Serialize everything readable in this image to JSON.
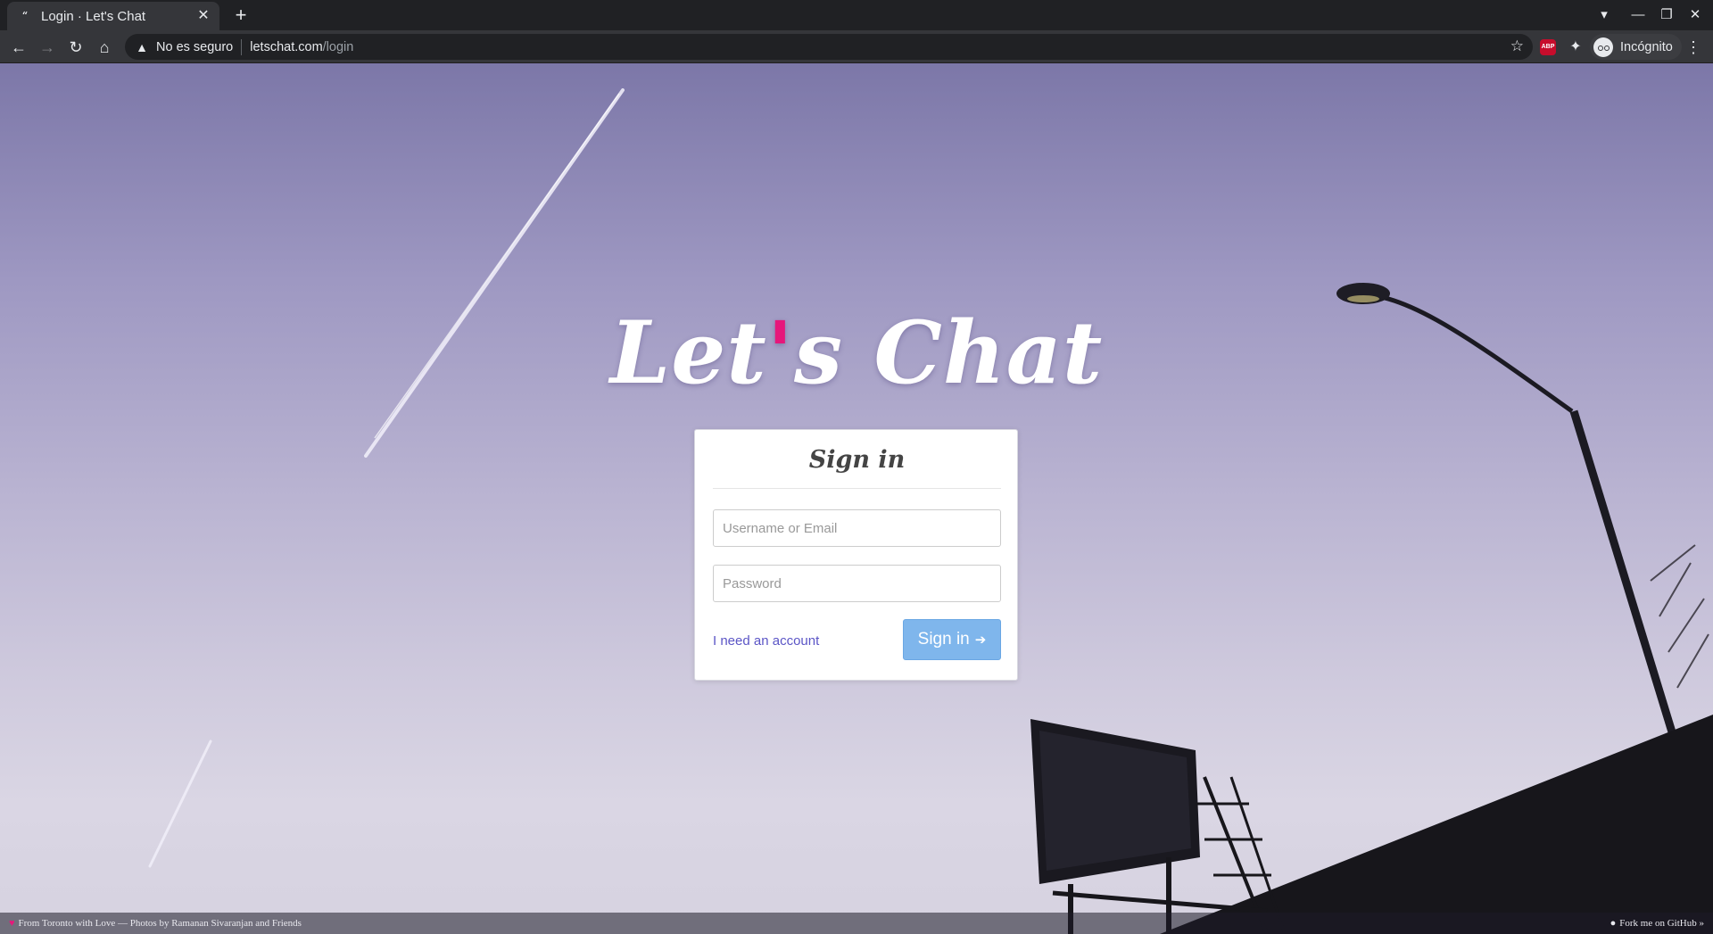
{
  "browser": {
    "tab": {
      "favicon": "“",
      "title": "Login · Let's Chat",
      "close": "✕"
    },
    "new_tab": "+",
    "window_controls": {
      "tab_search": "▾",
      "minimize": "—",
      "restore": "❐",
      "close": "✕"
    },
    "nav": {
      "back": "←",
      "forward": "→",
      "reload": "↻",
      "home": "⌂"
    },
    "address": {
      "warning_icon": "▲",
      "security_label": "No es seguro",
      "host": "letschat.com",
      "path": "/login",
      "star": "☆"
    },
    "extensions": {
      "abp": "ABP",
      "puzzle": "✦"
    },
    "profile_label": "Incógnito",
    "menu": "⋮"
  },
  "page": {
    "logo": {
      "part1": "Let",
      "apostrophe": "'",
      "part2": "s Chat"
    },
    "signin": {
      "title": "Sign in",
      "username_placeholder": "Username or Email",
      "password_placeholder": "Password",
      "account_link": "I need an account",
      "button_label": "Sign in",
      "button_icon": "➔"
    },
    "footer": {
      "heart": "♥",
      "credit": "From Toronto with Love — Photos by Ramanan Sivaranjan and Friends",
      "github_icon": "●",
      "github": "Fork me on GitHub »"
    }
  }
}
